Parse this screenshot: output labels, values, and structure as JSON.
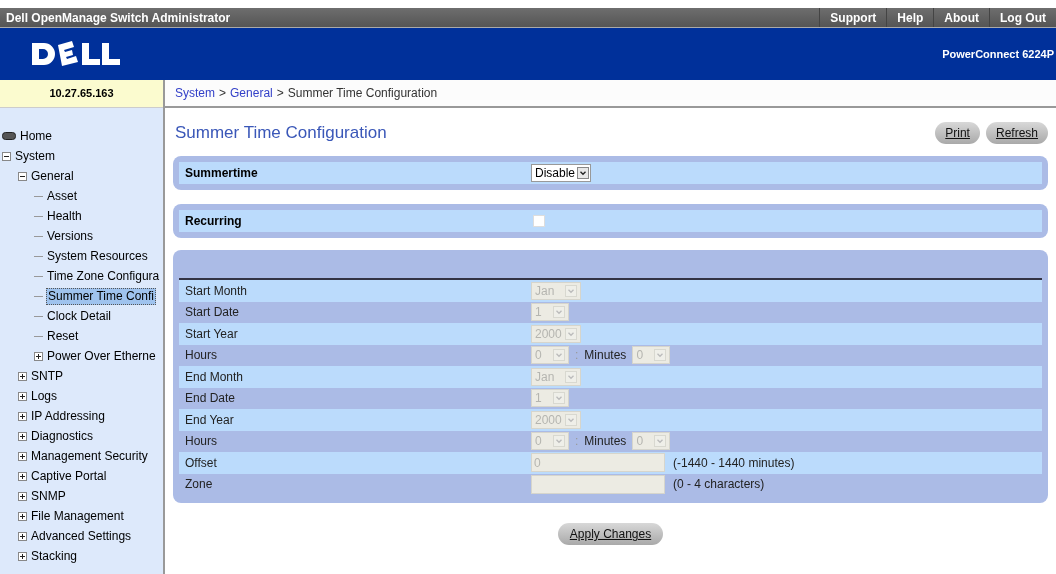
{
  "window": {
    "title": "Dell OpenManage Switch Administrator"
  },
  "top_links": [
    "Support",
    "Help",
    "About",
    "Log Out"
  ],
  "banner": {
    "product": "PowerConnect 6224P"
  },
  "ip_address": "10.27.65.163",
  "breadcrumb": [
    {
      "label": "System",
      "link": true
    },
    {
      "label": ">",
      "link": false
    },
    {
      "label": "General",
      "link": true
    },
    {
      "label": ">",
      "link": false
    },
    {
      "label": "Summer Time Configuration",
      "link": false
    }
  ],
  "tree": [
    {
      "label": "Home",
      "kind": "home",
      "selected": false
    },
    {
      "label": "System",
      "kind": "folder",
      "expanded": true,
      "selected": false,
      "children": [
        {
          "label": "General",
          "kind": "folder",
          "expanded": true,
          "selected": false,
          "children": [
            {
              "label": "Asset",
              "kind": "leaf",
              "selected": false
            },
            {
              "label": "Health",
              "kind": "leaf",
              "selected": false
            },
            {
              "label": "Versions",
              "kind": "leaf",
              "selected": false
            },
            {
              "label": "System Resources",
              "kind": "leaf",
              "selected": false
            },
            {
              "label": "Time Zone Configura",
              "kind": "leaf",
              "selected": false
            },
            {
              "label": "Summer Time Confi",
              "kind": "leaf",
              "selected": true
            },
            {
              "label": "Clock Detail",
              "kind": "leaf",
              "selected": false
            },
            {
              "label": "Reset",
              "kind": "leaf",
              "selected": false
            },
            {
              "label": "Power Over Etherne",
              "kind": "folder",
              "expanded": false,
              "selected": false
            }
          ]
        },
        {
          "label": "SNTP",
          "kind": "folder",
          "expanded": false,
          "selected": false
        },
        {
          "label": "Logs",
          "kind": "folder",
          "expanded": false,
          "selected": false
        },
        {
          "label": "IP Addressing",
          "kind": "folder",
          "expanded": false,
          "selected": false
        },
        {
          "label": "Diagnostics",
          "kind": "folder",
          "expanded": false,
          "selected": false
        },
        {
          "label": "Management Security",
          "kind": "folder",
          "expanded": false,
          "selected": false
        },
        {
          "label": "Captive Portal",
          "kind": "folder",
          "expanded": false,
          "selected": false
        },
        {
          "label": "SNMP",
          "kind": "folder",
          "expanded": false,
          "selected": false
        },
        {
          "label": "File Management",
          "kind": "folder",
          "expanded": false,
          "selected": false
        },
        {
          "label": "Advanced Settings",
          "kind": "folder",
          "expanded": false,
          "selected": false
        },
        {
          "label": "Stacking",
          "kind": "folder",
          "expanded": false,
          "selected": false
        }
      ]
    }
  ],
  "page": {
    "title": "Summer Time Configuration",
    "buttons": [
      "Print",
      "Refresh"
    ]
  },
  "summertime": {
    "label": "Summertime",
    "value": "Disable"
  },
  "recurring": {
    "label": "Recurring",
    "checked": false
  },
  "fields": [
    {
      "kind": "select",
      "label": "Start Month",
      "value": "Jan",
      "disabled": true
    },
    {
      "kind": "select",
      "label": "Start Date",
      "value": "1",
      "disabled": true
    },
    {
      "kind": "select",
      "label": "Start Year",
      "value": "2000",
      "disabled": true
    },
    {
      "kind": "time",
      "label": "Hours",
      "value": "0",
      "separator": ":",
      "minutes_label": "Minutes",
      "minutes_value": "0",
      "disabled": true
    },
    {
      "kind": "select",
      "label": "End Month",
      "value": "Jan",
      "disabled": true
    },
    {
      "kind": "select",
      "label": "End Date",
      "value": "1",
      "disabled": true
    },
    {
      "kind": "select",
      "label": "End Year",
      "value": "2000",
      "disabled": true
    },
    {
      "kind": "time",
      "label": "Hours",
      "value": "0",
      "separator": ":",
      "minutes_label": "Minutes",
      "minutes_value": "0",
      "disabled": true
    },
    {
      "kind": "text",
      "label": "Offset",
      "value": "0",
      "hint": "(-1440 - 1440 minutes)",
      "disabled": true
    },
    {
      "kind": "text",
      "label": "Zone",
      "hint": "(0 - 4 characters)",
      "disabled": true
    }
  ],
  "apply_button": "Apply Changes"
}
